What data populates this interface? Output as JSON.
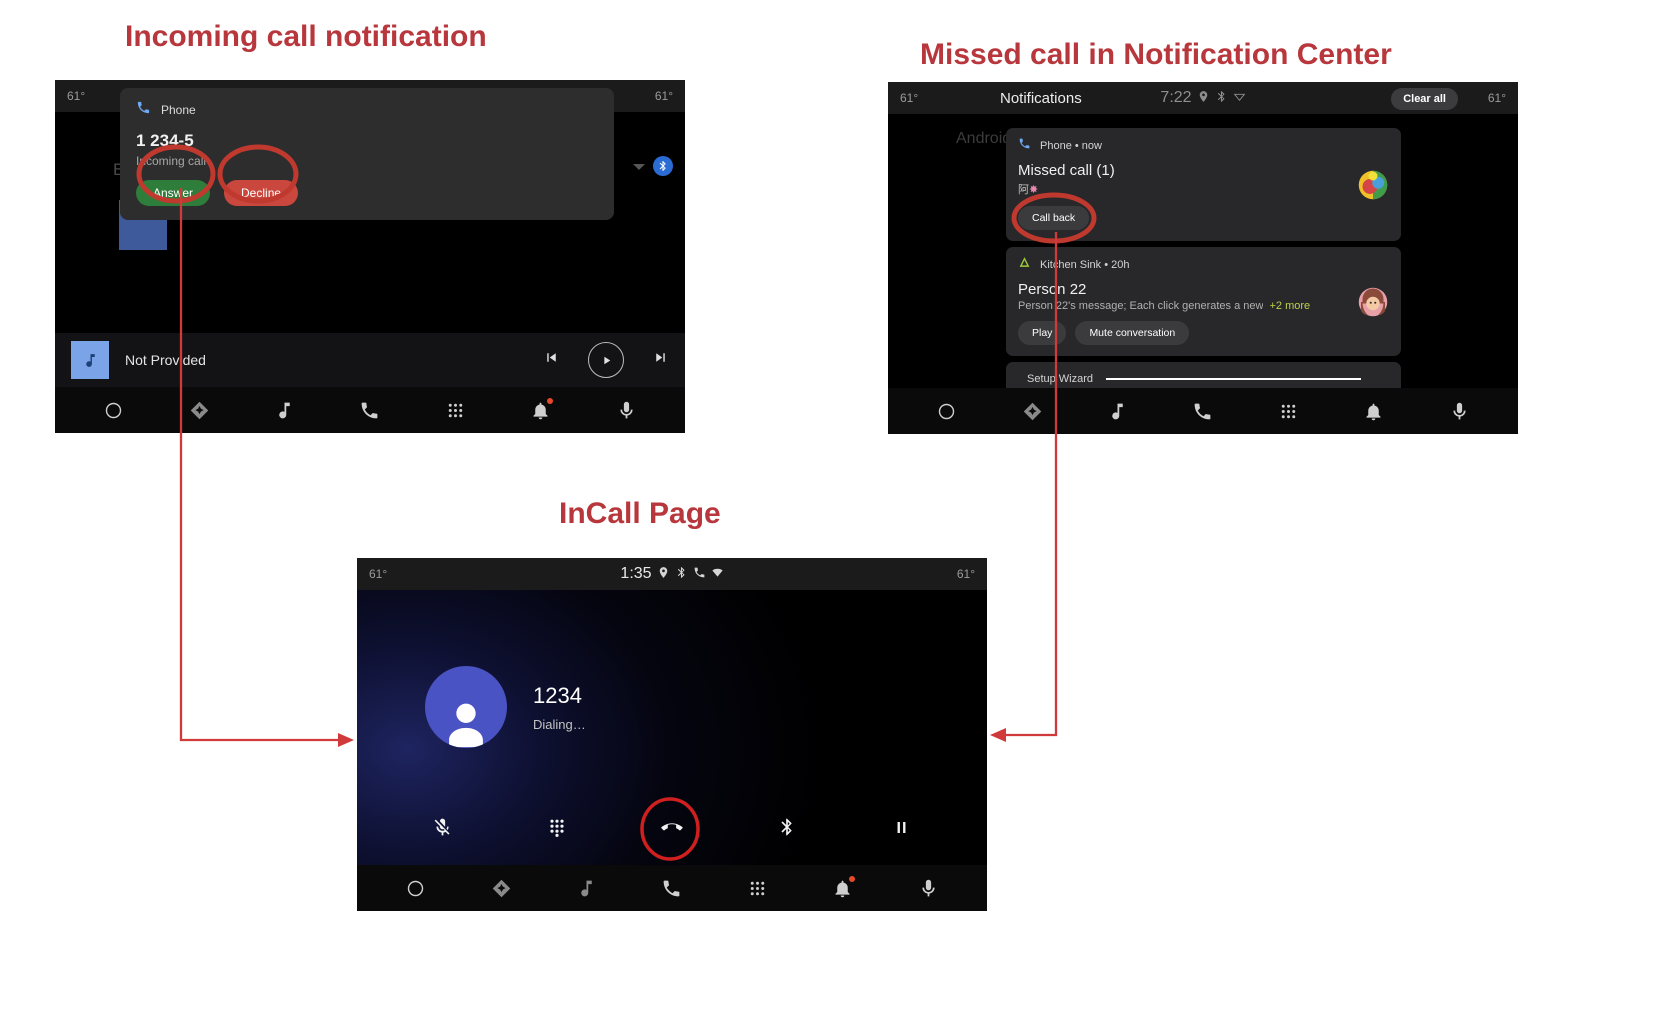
{
  "annotations": {
    "titles": [
      {
        "id": "incoming",
        "text": "Incoming call notification"
      },
      {
        "id": "missed",
        "text": "Missed call in Notification Center"
      },
      {
        "id": "incall",
        "text": "InCall Page"
      }
    ],
    "color": "#b8373c"
  },
  "incoming_call_screen": {
    "status_bar": {
      "temp_left": "61°",
      "temp_right": "61°"
    },
    "background": {
      "label": "B",
      "bluetooth_icon": "bluetooth-icon"
    },
    "heads_up": {
      "app_icon": "phone-icon",
      "app_name": "Phone",
      "title": "1 234-5",
      "subtitle": "Incoming call",
      "answer_label": "Answer",
      "decline_label": "Decline",
      "answer_color": "#2f7d3b",
      "decline_color": "#c9473d"
    },
    "media_bar": {
      "art_icon": "music-note-icon",
      "title": "Not Provided",
      "prev_icon": "skip-previous-icon",
      "play_icon": "play-icon",
      "next_icon": "skip-next-icon"
    },
    "nav_bar": [
      {
        "icon": "home-circle-icon",
        "label": "Home"
      },
      {
        "icon": "navigation-icon",
        "label": "Navigation"
      },
      {
        "icon": "music-note-icon",
        "label": "Media"
      },
      {
        "icon": "phone-icon",
        "label": "Phone"
      },
      {
        "icon": "apps-grid-icon",
        "label": "Apps"
      },
      {
        "icon": "bell-icon",
        "label": "Notifications",
        "badge": true
      },
      {
        "icon": "microphone-icon",
        "label": "Assistant"
      }
    ]
  },
  "notification_center_screen": {
    "status_bar": {
      "temp_left": "61°",
      "temp_right": "61°",
      "title": "Notifications",
      "clock": "7:22",
      "icons": [
        "location-icon",
        "bluetooth-icon",
        "wifi-icon"
      ],
      "clear_all_label": "Clear all"
    },
    "background_label": "Android",
    "cards": [
      {
        "app_icon": "phone-icon",
        "app_name": "Phone • now",
        "headline": "Missed call (1)",
        "sub_cjk": "阿",
        "actions": [
          "Call back"
        ],
        "avatar": "colorful-avatar"
      },
      {
        "app_icon": "kitchen-sink-icon",
        "app_name": "Kitchen Sink • 20h",
        "headline": "Person 22",
        "body": "Person 22's message; Each click generates a new",
        "more_label": "+2 more",
        "actions": [
          "Play",
          "Mute conversation"
        ],
        "avatar": "person-avatar"
      },
      {
        "app_icon": "gear-icon",
        "app_name": "Setup Wizard",
        "progress": 100
      }
    ],
    "nav_bar": [
      {
        "icon": "home-circle-icon",
        "label": "Home"
      },
      {
        "icon": "navigation-icon",
        "label": "Navigation"
      },
      {
        "icon": "music-note-icon",
        "label": "Media"
      },
      {
        "icon": "phone-icon",
        "label": "Phone"
      },
      {
        "icon": "apps-grid-icon",
        "label": "Apps"
      },
      {
        "icon": "bell-icon",
        "label": "Notifications"
      },
      {
        "icon": "microphone-icon",
        "label": "Assistant"
      }
    ]
  },
  "incall_screen": {
    "status_bar": {
      "temp_left": "61°",
      "temp_right": "61°",
      "clock": "1:35",
      "icons": [
        "location-icon",
        "bluetooth-icon",
        "call-icon",
        "wifi-icon"
      ]
    },
    "caller": {
      "avatar_icon": "person-avatar-icon",
      "number": "1234",
      "state": "Dialing…"
    },
    "controls": [
      {
        "icon": "mic-off-icon",
        "label": "Mute"
      },
      {
        "icon": "dialpad-icon",
        "label": "Dialpad"
      },
      {
        "icon": "call-end-icon",
        "label": "End call",
        "highlighted": true
      },
      {
        "icon": "bluetooth-icon",
        "label": "Bluetooth"
      },
      {
        "icon": "pause-icon",
        "label": "Hold"
      }
    ],
    "nav_bar": [
      {
        "icon": "home-circle-icon",
        "label": "Home"
      },
      {
        "icon": "navigation-icon",
        "label": "Navigation"
      },
      {
        "icon": "music-note-icon",
        "label": "Media"
      },
      {
        "icon": "phone-icon",
        "label": "Phone"
      },
      {
        "icon": "apps-grid-icon",
        "label": "Apps"
      },
      {
        "icon": "bell-icon",
        "label": "Notifications",
        "badge": true
      },
      {
        "icon": "microphone-icon",
        "label": "Assistant"
      }
    ]
  }
}
